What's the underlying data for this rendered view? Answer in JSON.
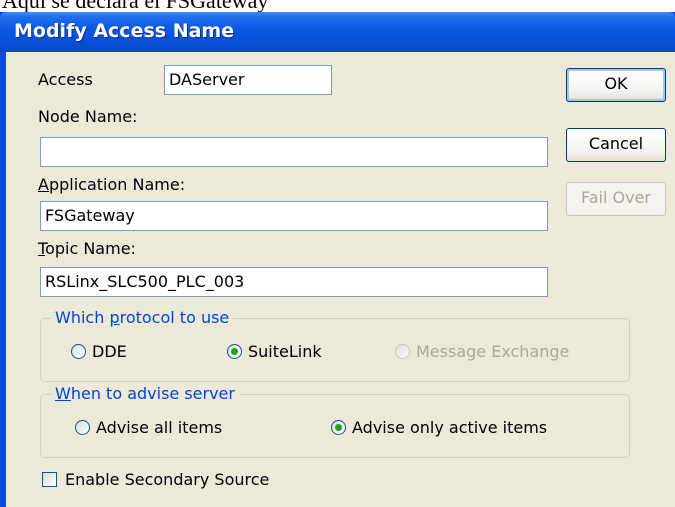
{
  "caption": "Aqui se declara el FSGateway",
  "window": {
    "title": "Modify Access Name"
  },
  "form": {
    "access": {
      "label": "Access",
      "value": "DAServer"
    },
    "node_name": {
      "label": "Node Name:",
      "value": ""
    },
    "application_name": {
      "label_accel": "A",
      "label_rest": "pplication Name:",
      "value": "FSGateway"
    },
    "topic_name": {
      "label_accel": "T",
      "label_rest": "opic Name:",
      "value": "RSLinx_SLC500_PLC_003"
    }
  },
  "buttons": {
    "ok": "OK",
    "cancel": "Cancel",
    "fail_over": "Fail Over"
  },
  "protocol_group": {
    "label_before": "Which ",
    "label_accel": "p",
    "label_after": "rotocol to use",
    "options": [
      {
        "label": "DDE",
        "selected": false,
        "enabled": true
      },
      {
        "label": "SuiteLink",
        "selected": true,
        "enabled": true
      },
      {
        "label": "Message Exchange",
        "selected": false,
        "enabled": false
      }
    ]
  },
  "advise_group": {
    "label_accel": "W",
    "label_after": "hen to advise server",
    "options": [
      {
        "label": "Advise all items",
        "selected": false
      },
      {
        "label": "Advise only active items",
        "selected": true
      }
    ]
  },
  "secondary_source": {
    "label": "Enable Secondary Source",
    "checked": false
  }
}
